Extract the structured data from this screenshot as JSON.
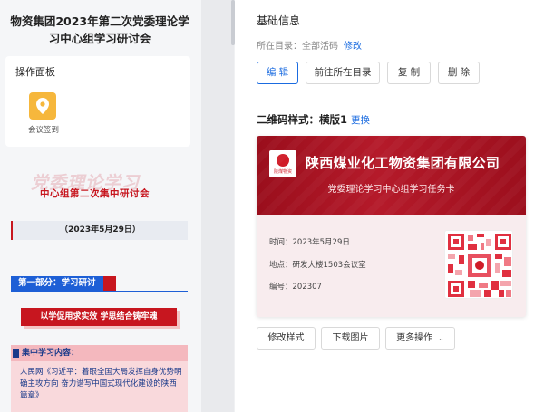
{
  "preview": {
    "title": "物资集团2023年第二次党委理论学习中心组学习研讨会",
    "panel_title": "操作面板",
    "op_label": "会议签到",
    "banner_faint": "党委理论学习",
    "banner_strong": "中心组第二次集中研讨会",
    "date_bar": "（2023年5月29日）",
    "section_head": "第一部分：学习研讨",
    "slogan": "以学促用求实效 学思结合铸牢魂",
    "study_head": "集中学习内容：",
    "study_source": "人民网",
    "study_text": "《习近平：着眼全国大局发挥自身优势明确主攻方向 奋力谱写中国式现代化建设的陕西篇章》"
  },
  "info": {
    "basic_title": "基础信息",
    "dir_label": "所在目录：",
    "dir_value": "全部活码",
    "dir_modify": "修改",
    "buttons": [
      "编 辑",
      "前往所在目录",
      "复 制",
      "删 除"
    ]
  },
  "qr_style": {
    "label": "二维码样式：",
    "value": "横版1",
    "change": "更换"
  },
  "card": {
    "logo_text": "陕煤物资",
    "company": "陕西煤业化工物资集团有限公司",
    "task": "党委理论学习中心组学习任务卡",
    "time_label": "时间：",
    "time_value": "2023年5月29日",
    "place_label": "地点：",
    "place_value": "研发大楼1503会议室",
    "code_label": "编号：",
    "code_value": "202307"
  },
  "actions": {
    "modify_style": "修改样式",
    "download": "下载图片",
    "more": "更多操作",
    "more_icon": "chevron-down-icon"
  },
  "colors": {
    "primary": "#1a6be0",
    "brand_red": "#c7161f",
    "card_red": "#a51424"
  }
}
